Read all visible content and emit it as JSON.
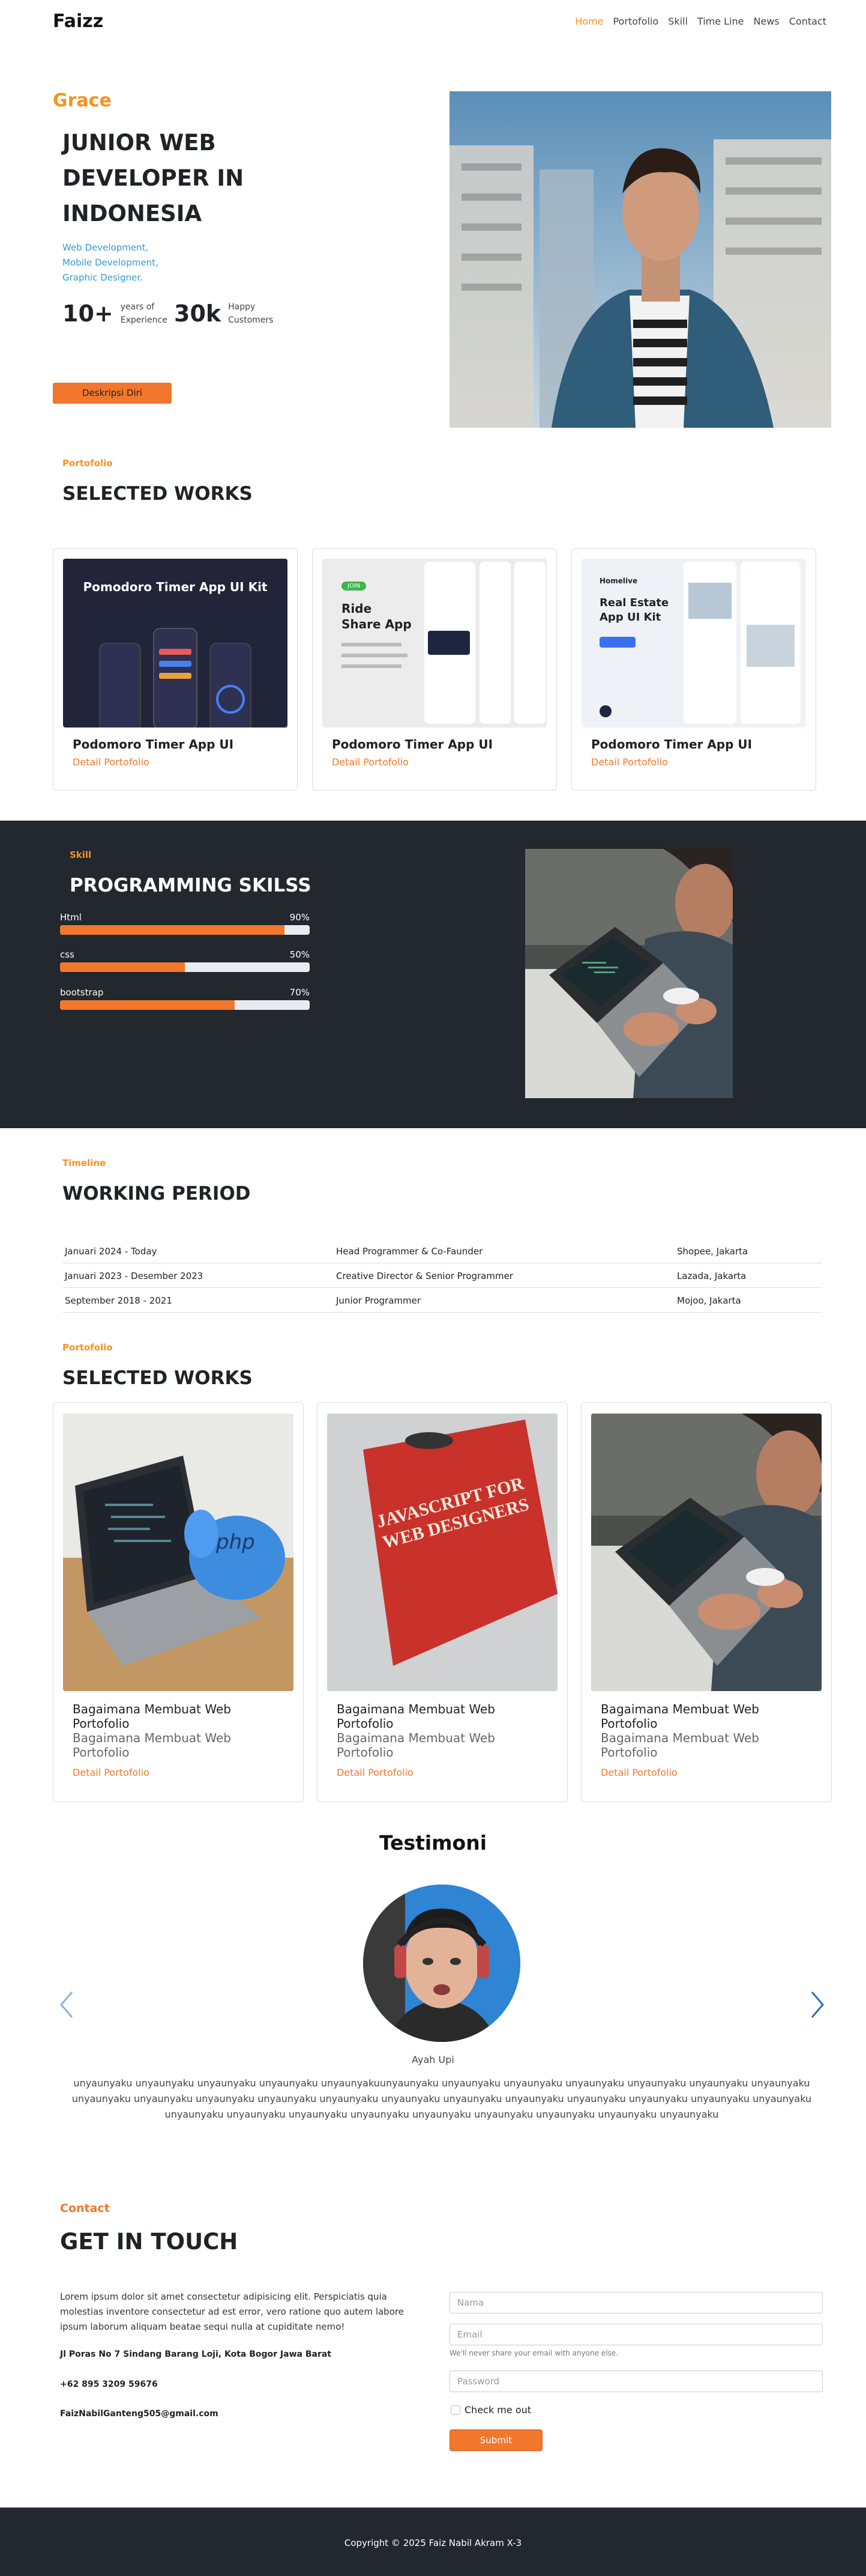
{
  "nav": {
    "logo": "Faizz",
    "items": [
      "Home",
      "Portofolio",
      "Skill",
      "Time Line",
      "News",
      "Contact"
    ]
  },
  "hero": {
    "name": "Grace",
    "title": "JUNIOR WEB DEVELOPER IN INDONESIA",
    "subtitle_lines": [
      "Web Development,",
      "Mobile Development,",
      "Graphic Designer."
    ],
    "stats": [
      {
        "num": "10+",
        "label_1": "years of",
        "label_2": "Experience"
      },
      {
        "num": "30k",
        "label_1": "Happy",
        "label_2": "Customers"
      }
    ],
    "button": "Deskripsi Diri"
  },
  "works1": {
    "tag": "Portofolio",
    "title": "SELECTED WORKS",
    "cards": [
      {
        "title": "Podomoro Timer App UI",
        "link": "Detail Portofolio",
        "img_title": "Pomodoro Timer App UI  Kit"
      },
      {
        "title": "Podomoro Timer App UI",
        "link": "Detail Portofolio",
        "img_title": "Ride Share App",
        "img_badge": "JOIN"
      },
      {
        "title": "Podomoro Timer App UI",
        "link": "Detail Portofolio",
        "img_title": "Real Estate App UI Kit",
        "img_brand": "Homelive"
      }
    ]
  },
  "skills": {
    "tag": "Skill",
    "title": "PROGRAMMING SKILSS",
    "items": [
      {
        "name": "Html",
        "pct_label": "90%",
        "pct": 90
      },
      {
        "name": "css",
        "pct_label": "50%",
        "pct": 50
      },
      {
        "name": "bootstrap",
        "pct_label": "70%",
        "pct": 70
      }
    ]
  },
  "timeline": {
    "tag": "Timeline",
    "title": "WORKING PERIOD",
    "rows": [
      {
        "period": "Januari 2024 - Today",
        "role": "Head Programmer & Co-Faunder",
        "place": "Shopee, Jakarta"
      },
      {
        "period": "Januari 2023 - Desember 2023",
        "role": "Creative Director & Senior Programmer",
        "place": "Lazada, Jakarta"
      },
      {
        "period": "September 2018 - 2021",
        "role": "Junior Programmer",
        "place": "Mojoo, Jakarta"
      }
    ]
  },
  "works2": {
    "tag": "Portofolio",
    "title": "SELECTED WORKS",
    "cards": [
      {
        "title": "Bagaimana Membuat Web Portofolio",
        "subtitle": "Bagaimana Membuat Web Portofolio",
        "link": "Detail Portofolio"
      },
      {
        "title": "Bagaimana Membuat Web Portofolio",
        "subtitle": "Bagaimana Membuat Web Portofolio",
        "link": "Detail Portofolio",
        "book_line1": "JAVASCRIPT FOR",
        "book_line2": "WEB DESIGNERS"
      },
      {
        "title": "Bagaimana Membuat Web Portofolio",
        "subtitle": "Bagaimana Membuat Web Portofolio",
        "link": "Detail Portofolio"
      }
    ]
  },
  "testimoni": {
    "title": "Testimoni",
    "person": "Ayah Upi",
    "text": "unyaunyaku unyaunyaku unyaunyaku unyaunyaku unyaunyakuunyaunyaku unyaunyaku unyaunyaku unyaunyaku unyaunyaku unyaunyaku unyaunyaku unyaunyaku unyaunyaku unyaunyaku unyaunyaku unyaunyaku unyaunyaku unyaunyaku unyaunyaku unyaunyaku unyaunyaku unyaunyaku unyaunyaku unyaunyaku unyaunyaku unyaunyaku unyaunyaku unyaunyaku unyaunyaku unyaunyaku unyaunyaku unyaunyaku"
  },
  "contact": {
    "tag": "Contact",
    "title": "GET IN TOUCH",
    "desc": "Lorem ipsum dolor sit amet consectetur adipisicing elit. Perspiciatis quia molestias inventore consectetur ad est error, vero ratione quo autem labore ipsum laborum aliquam beatae sequi nulla at cupiditate nemo!",
    "address": "Jl Poras No 7 Sindang Barang Loji, Kota Bogor Jawa Barat",
    "phone": "+62 895 3209 59676",
    "email": "FaizNabilGanteng505@gmail.com",
    "form": {
      "name_ph": "Nama",
      "email_ph": "Email",
      "email_help": "We'll never share your email with anyone else.",
      "password_ph": "Password",
      "check_label": "Check me out",
      "submit": "Submit"
    }
  },
  "footer": {
    "copyright": "Copyright © 2025 Faiz Nabil Akram X-3"
  },
  "colors": {
    "accent": "#f2772d",
    "accent_yellow": "#f7931e",
    "dark": "#23272e",
    "link_blue": "#2f9bd6"
  }
}
